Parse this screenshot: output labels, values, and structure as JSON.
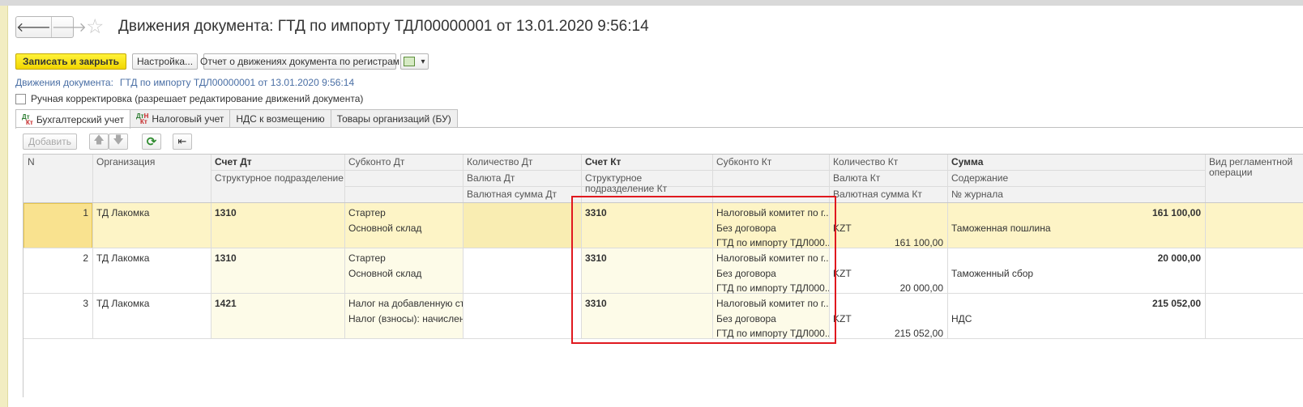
{
  "window": {
    "title": "Движения документа: ГТД по импорту ТДЛ00000001 от 13.01.2020 9:56:14"
  },
  "nav": {
    "back": "🡐",
    "forward": "🡒",
    "favorite": "☆"
  },
  "toolbar": {
    "save_close": "Записать и закрыть",
    "settings": "Настройка...",
    "report": "Отчет о движениях документа по регистрам",
    "more": "▾"
  },
  "breadcrumb": {
    "label": "Движения документа:",
    "link": "ГТД по импорту ТДЛ00000001 от 13.01.2020 9:56:14"
  },
  "manual_edit": {
    "label": "Ручная корректировка (разрешает редактирование движений документа)",
    "checked": false
  },
  "tabs": [
    {
      "label": "Бухгалтерский учет",
      "active": true
    },
    {
      "label": "Налоговый учет",
      "active": false
    },
    {
      "label": "НДС к возмещению",
      "active": false
    },
    {
      "label": "Товары организаций (БУ)",
      "active": false
    }
  ],
  "tab_icon": {
    "dt": "Дт",
    "kt": "Кт",
    "n": "Н"
  },
  "table_toolbar": {
    "add": "Добавить",
    "up": "🡅",
    "down": "🡇",
    "refresh": "⟳",
    "load": "⇤"
  },
  "columns": {
    "n": "N",
    "org": "Организация",
    "schet_dt": "Счет Дт",
    "podr_dt": "Структурное подразделение Дт",
    "subkonto_dt": "Субконто Дт",
    "kol_dt": "Количество Дт",
    "val_dt": "Валюта Дт",
    "valsum_dt": "Валютная сумма Дт",
    "schet_kt": "Счет Кт",
    "podr_kt": "Структурное подразделение Кт",
    "subkonto_kt": "Субконто Кт",
    "kol_kt": "Количество Кт",
    "val_kt": "Валюта Кт",
    "valsum_kt": "Валютная сумма Кт",
    "summa": "Сумма",
    "soderzhanie": "Содержание",
    "zhurnal": "№ журнала",
    "vid": "Вид регламентной операции"
  },
  "rows": [
    {
      "n": "1",
      "org": "ТД Лакомка",
      "schet_dt": "1310",
      "sub_dt1": "Стартер",
      "sub_dt2": "Основной склад",
      "schet_kt": "3310",
      "sub_kt1": "Налоговый комитет по г....",
      "sub_kt2": "Без договора",
      "sub_kt3": "ГТД по импорту ТДЛ000...",
      "val_kt": "KZT",
      "valsum_kt": "161 100,00",
      "summa": "161 100,00",
      "soderzhanie": "Таможенная пошлина"
    },
    {
      "n": "2",
      "org": "ТД Лакомка",
      "schet_dt": "1310",
      "sub_dt1": "Стартер",
      "sub_dt2": "Основной склад",
      "schet_kt": "3310",
      "sub_kt1": "Налоговый комитет по г....",
      "sub_kt2": "Без договора",
      "sub_kt3": "ГТД по импорту ТДЛ000...",
      "val_kt": "KZT",
      "valsum_kt": "20 000,00",
      "summa": "20 000,00",
      "soderzhanie": "Таможенный сбор"
    },
    {
      "n": "3",
      "org": "ТД Лакомка",
      "schet_dt": "1421",
      "sub_dt1": "Налог на добавленную ст...",
      "sub_dt2": "Налог (взносы): начислен...",
      "schet_kt": "3310",
      "sub_kt1": "Налоговый комитет по г....",
      "sub_kt2": "Без договора",
      "sub_kt3": "ГТД по импорту ТДЛ000...",
      "val_kt": "KZT",
      "valsum_kt": "215 052,00",
      "summa": "215 052,00",
      "soderzhanie": "НДС"
    }
  ],
  "colors": {
    "accent_yellow": "#f2d600",
    "selected_row": "#fdf4c6",
    "highlight_box": "#e0191f",
    "link": "#4a6fa5"
  }
}
